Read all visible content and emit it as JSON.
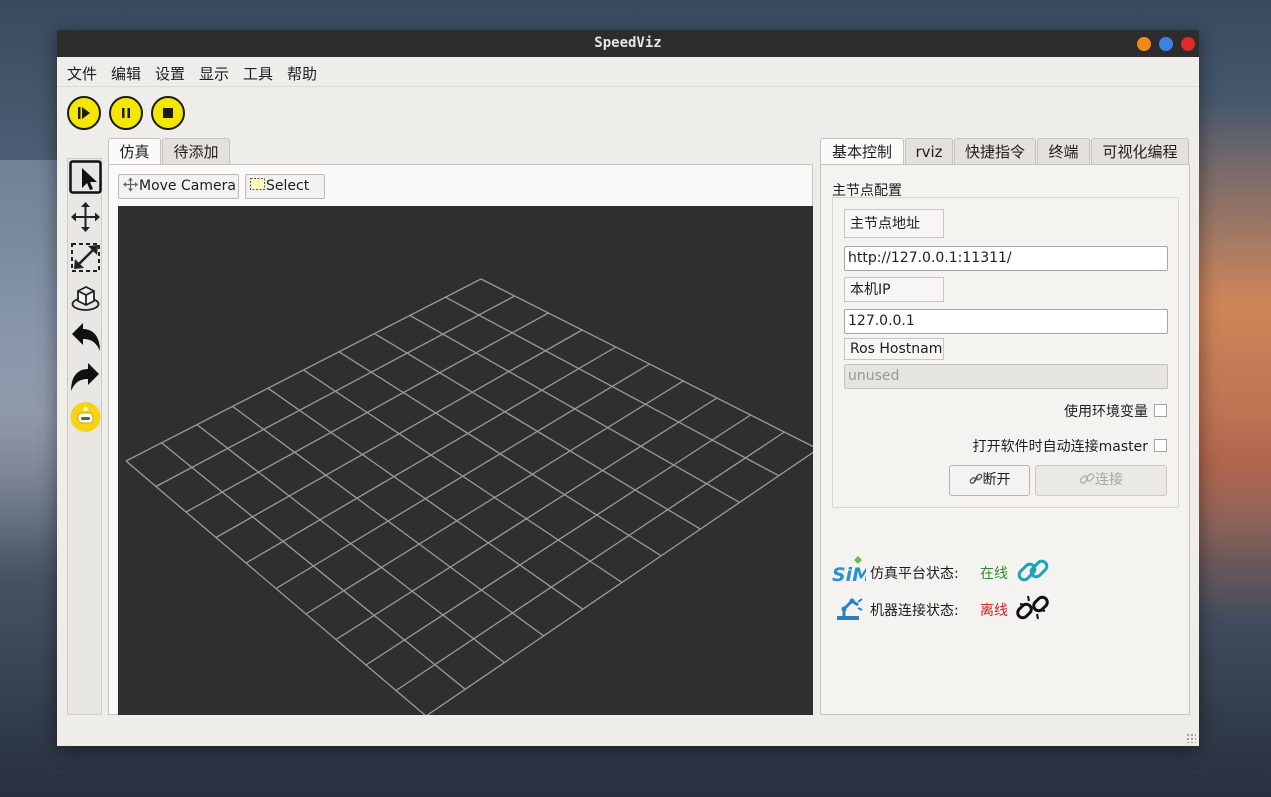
{
  "window": {
    "title": "SpeedViz"
  },
  "menu": [
    "文件",
    "编辑",
    "设置",
    "显示",
    "工具",
    "帮助"
  ],
  "toolbar": {
    "play": "play-icon",
    "pause": "pause-icon",
    "stop": "stop-icon"
  },
  "tools": [
    "select-pointer-icon",
    "move-arrows-icon",
    "resize-icon",
    "cube-icon",
    "undo-arrow-icon",
    "redo-arrow-icon",
    "robot-icon"
  ],
  "left_tabs": [
    "仿真",
    "待添加"
  ],
  "viewport_toolbar": {
    "move_camera": "Move Camera",
    "select": "Select"
  },
  "right_tabs": [
    "基本控制",
    "rviz",
    "快捷指令",
    "终端",
    "可视化编程"
  ],
  "master": {
    "group_title": "主节点配置",
    "uri_label": "主节点地址",
    "uri_value": "http://127.0.0.1:11311/",
    "ip_label": "本机IP",
    "ip_value": "127.0.0.1",
    "hostname_label": "Ros Hostname",
    "hostname_placeholder": "unused",
    "use_env": "使用环境变量",
    "auto_connect": "打开软件时自动连接master",
    "disconnect": "断开",
    "connect": "连接"
  },
  "status": {
    "sim_label": "仿真平台状态:",
    "sim_value": "在线",
    "robot_label": "机器连接状态:",
    "robot_value": "离线"
  },
  "colors": {
    "accent_yellow": "#f3e600",
    "online": "#2f8a2f",
    "offline": "#cc1f1f",
    "viewport_bg": "#2f2f2f",
    "grid_line": "#9a9a9a"
  }
}
